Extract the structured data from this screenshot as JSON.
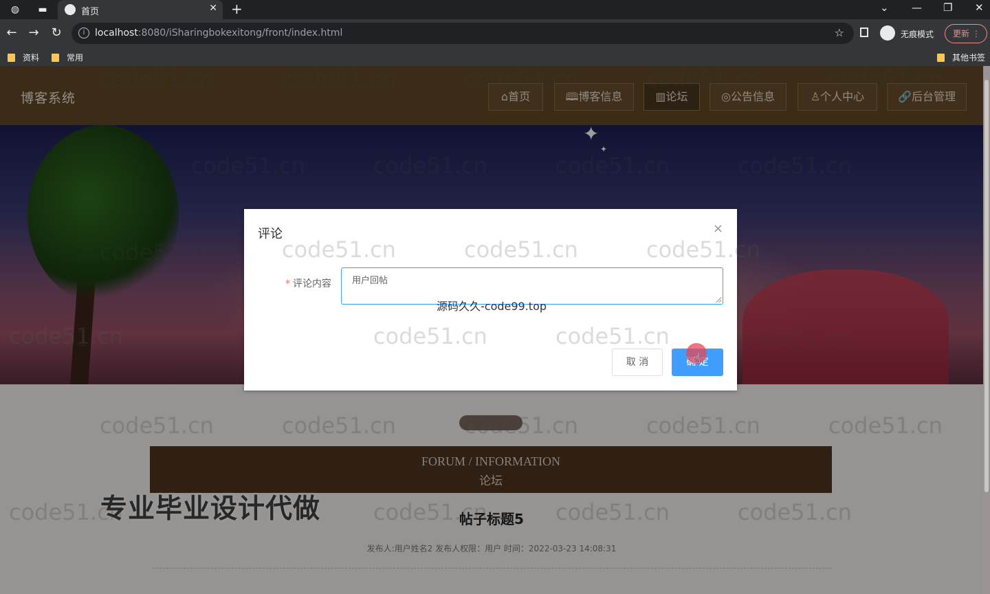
{
  "browser": {
    "tab_title": "首页",
    "url_host": "localhost",
    "url_rest": ":8080/iSharingbokexitong/front/index.html",
    "incognito_label": "无痕模式",
    "update_label": "更新",
    "bookmarks": [
      "资料",
      "常用"
    ],
    "other_bookmarks": "其他书签"
  },
  "site": {
    "logo": "博客系统",
    "nav": [
      {
        "label": "⌂首页"
      },
      {
        "label": "🕮博客信息"
      },
      {
        "label": "▥论坛"
      },
      {
        "label": "◎公告信息"
      },
      {
        "label": "♙个人中心"
      },
      {
        "label": "🔗后台管理"
      }
    ]
  },
  "forum": {
    "title_en": "FORUM / INFORMATION",
    "title_zh": "论坛",
    "post_title": "帖子标题5",
    "post_meta": "发布人:用户姓名2   发布人权限：用户   时间：2022-03-23 14:08:31"
  },
  "promo_text": "专业毕业设计代做",
  "watermark": "code51.cn",
  "dialog": {
    "title": "评论",
    "close": "×",
    "field_label": "评论内容",
    "required_mark": "*",
    "textarea_value": "用户回帖",
    "source_note": "源码久久-code99.top",
    "cancel_label": "取 消",
    "ok_label": "确 定"
  },
  "colors": {
    "header_brown": "#5f4728",
    "primary_blue": "#409eff",
    "forum_box": "#4e3420"
  }
}
